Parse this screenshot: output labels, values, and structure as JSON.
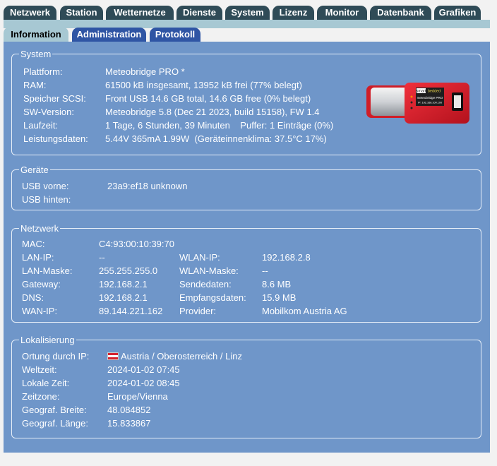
{
  "top_tabs": [
    "Netzwerk",
    "Station",
    "Wetternetze",
    "Dienste",
    "System",
    "Lizenz",
    "Monitor",
    "Datenbank",
    "Grafiken"
  ],
  "sub_tabs": [
    "Information",
    "Administration",
    "Protokoll"
  ],
  "active_sub_tab": "Information",
  "system": {
    "legend": "System",
    "rows": [
      {
        "label": "Plattform:",
        "value": "Meteobridge PRO *"
      },
      {
        "label": "RAM:",
        "value": "61500 kB insgesamt, 13952 kB frei (77% belegt)"
      },
      {
        "label": "Speicher SCSI:",
        "value": "Front USB 14.6 GB total, 14.6 GB free (0% belegt)"
      },
      {
        "label": "SW-Version:",
        "value": "Meteobridge 5.8 (Dec 21 2023, build 15158), FW 1.4"
      },
      {
        "label": "Laufzeit:",
        "value": "1 Tage, 6 Stunden, 39 Minuten    Puffer: 1 Einträge (0%)"
      },
      {
        "label": "Leistungsdaten:",
        "value": "5.44V 365mA 1.99W  (Geräteinnenklima: 37.5°C 17%)"
      }
    ],
    "device_label_brand_a": "smart",
    "device_label_brand_b": "bedded",
    "device_label_model": "meteobridge PRO",
    "device_label_ip": "IP: 192.168.100.100"
  },
  "geraete": {
    "legend": "Geräte",
    "rows": [
      {
        "label": "USB vorne:",
        "value": "23a9:ef18 unknown"
      },
      {
        "label": "USB hinten:",
        "value": ""
      }
    ]
  },
  "netzwerk": {
    "legend": "Netzwerk",
    "mac_label": "MAC:",
    "mac_value": "C4:93:00:10:39:70",
    "left": [
      {
        "label": "LAN-IP:",
        "value": "--"
      },
      {
        "label": "LAN-Maske:",
        "value": "255.255.255.0"
      },
      {
        "label": "Gateway:",
        "value": "192.168.2.1"
      },
      {
        "label": "DNS:",
        "value": "192.168.2.1"
      },
      {
        "label": "WAN-IP:",
        "value": "89.144.221.162"
      }
    ],
    "right": [
      {
        "label": "WLAN-IP:",
        "value": "192.168.2.8"
      },
      {
        "label": "WLAN-Maske:",
        "value": "--"
      },
      {
        "label": "Sendedaten:",
        "value": "8.6 MB"
      },
      {
        "label": "Empfangsdaten:",
        "value": "15.9 MB"
      },
      {
        "label": "Provider:",
        "value": "Mobilkom Austria AG"
      }
    ]
  },
  "lokalisierung": {
    "legend": "Lokalisierung",
    "rows": [
      {
        "label": "Ortung durch IP:",
        "value": "Austria / Oberosterreich / Linz"
      },
      {
        "label": "Weltzeit:",
        "value": "2024-01-02 07:45"
      },
      {
        "label": "Lokale Zeit:",
        "value": "2024-01-02 08:45"
      },
      {
        "label": "Zeitzone:",
        "value": "Europe/Vienna"
      },
      {
        "label": "Geograf. Breite:",
        "value": "48.084852"
      },
      {
        "label": "Geograf. Länge:",
        "value": "15.833867"
      }
    ]
  }
}
